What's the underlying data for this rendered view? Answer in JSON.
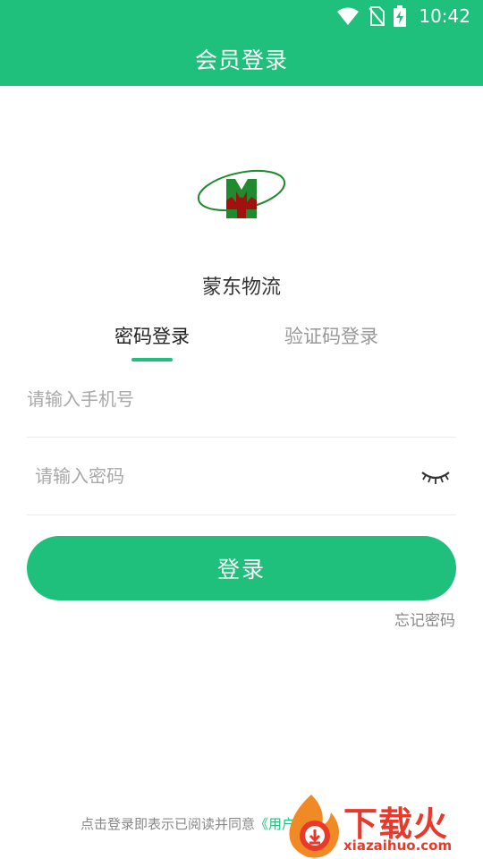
{
  "status_bar": {
    "time": "10:42",
    "icons": [
      "wifi-icon",
      "no-sim-icon",
      "battery-charging-icon"
    ]
  },
  "header": {
    "title": "会员登录"
  },
  "brand": {
    "logo_letter": "M",
    "company_name": "蒙东物流"
  },
  "tabs": [
    {
      "label": "密码登录",
      "active": true
    },
    {
      "label": "验证码登录",
      "active": false
    }
  ],
  "form": {
    "phone_placeholder": "请输入手机号",
    "phone_value": "",
    "password_placeholder": "请输入密码",
    "password_value": "",
    "password_toggle_icon": "eye-closed-icon",
    "submit_label": "登录",
    "forgot_label": "忘记密码"
  },
  "footer": {
    "agreement_text": "点击登录即表示已阅读并同意",
    "agreement_link": "《用户"
  },
  "watermark": {
    "text_cn": "下载火",
    "text_en": "xiazaihuo.com"
  },
  "colors": {
    "primary": "#1fbf7c",
    "logo_green": "#1f8a2e",
    "logo_red": "#a31010",
    "watermark_red": "#e8392a"
  }
}
